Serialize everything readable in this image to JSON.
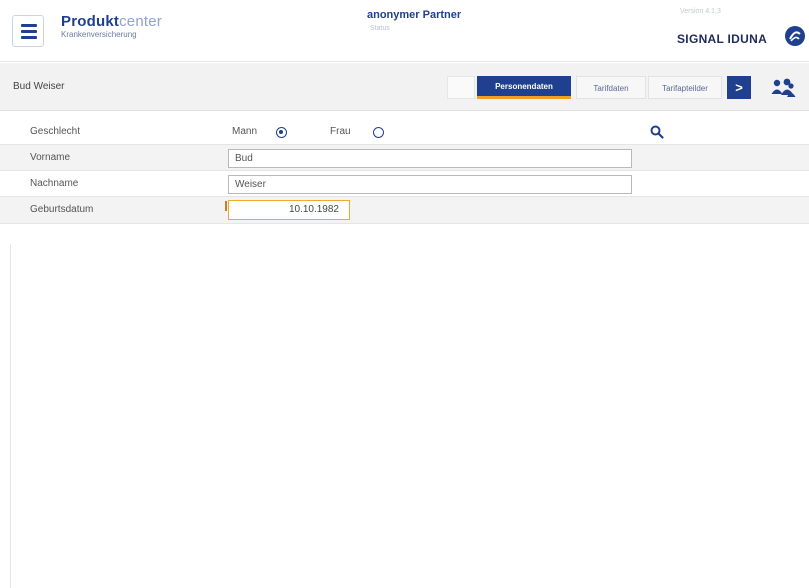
{
  "header": {
    "menu_icon": "hamburger-menu-icon",
    "app_title_bold": "Produkt",
    "app_title_light": "center",
    "app_subtitle": "Krankenversicherung",
    "partner_title": "anonymer Partner",
    "partner_subtitle": "Status",
    "version": "Version 4.1.3",
    "brand_name": "SIGNAL IDUNA",
    "brand_logo_icon": "signal-iduna-logo-icon",
    "brand_color": "#1f3f8f"
  },
  "toolbar": {
    "person_name": "Bud Weiser",
    "tabs": [
      {
        "label": "Personendaten",
        "active": true
      },
      {
        "label": "Tarifdaten",
        "active": false
      },
      {
        "label": "Tarifapteilder",
        "active": false
      }
    ],
    "next_label": ">",
    "group_icon": "people-group-icon"
  },
  "form": {
    "gender": {
      "label": "Geschlecht",
      "options": [
        {
          "label": "Mann",
          "checked": true
        },
        {
          "label": "Frau",
          "checked": false
        }
      ],
      "search_icon": "search-icon"
    },
    "first_name": {
      "label": "Vorname",
      "value": "Bud"
    },
    "last_name": {
      "label": "Nachname",
      "value": "Weiser"
    },
    "birth_date": {
      "label": "Geburtsdatum",
      "value": "10.10.1982"
    }
  },
  "colors": {
    "primary": "#1f3f8f",
    "accent": "#f0a020",
    "row_alt": "#f3f3f3"
  }
}
